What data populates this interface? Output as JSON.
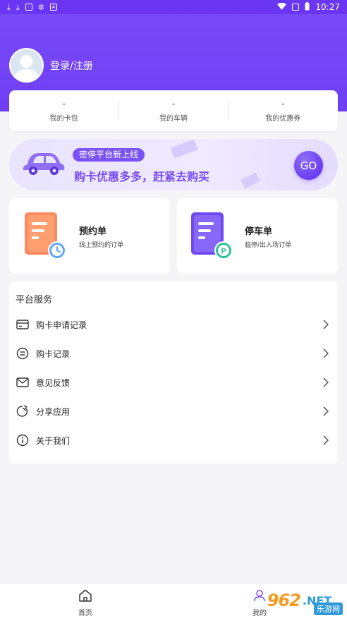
{
  "status_bar": {
    "time": "10:27",
    "left_icons": [
      "download-icon",
      "download-icon",
      "app-icon",
      "app-icon",
      "notification-icon"
    ],
    "right_icons": [
      "wifi-icon",
      "vibrate-icon",
      "battery-icon"
    ]
  },
  "user": {
    "login_label": "登录/注册"
  },
  "stats": [
    {
      "value": "-",
      "label": "我的卡包"
    },
    {
      "value": "-",
      "label": "我的车辆"
    },
    {
      "value": "-",
      "label": "我的优惠券"
    }
  ],
  "banner": {
    "tag": "密停平台新上线",
    "slogan": "购卡优惠多多，赶紧去购买",
    "go_label": "GO"
  },
  "orders": [
    {
      "title": "预约单",
      "subtitle": "线上预约的订单",
      "icon": "reservation-order-icon"
    },
    {
      "title": "停车单",
      "subtitle": "临停/出入场订单",
      "icon": "parking-order-icon"
    }
  ],
  "services": {
    "title": "平台服务",
    "items": [
      {
        "label": "购卡申请记录",
        "icon": "card-icon"
      },
      {
        "label": "购卡记录",
        "icon": "record-icon"
      },
      {
        "label": "意见反馈",
        "icon": "mail-icon"
      },
      {
        "label": "分享应用",
        "icon": "share-icon"
      },
      {
        "label": "关于我们",
        "icon": "info-icon"
      }
    ]
  },
  "tabbar": {
    "home_label": "首页",
    "mine_label": "我的"
  },
  "watermark": {
    "number": "962",
    "suffix": ".NET",
    "site": "乐游网"
  },
  "colors": {
    "primary": "#6f3ef5",
    "banner_text": "#7a4cf2",
    "background": "#f5f5f7"
  }
}
